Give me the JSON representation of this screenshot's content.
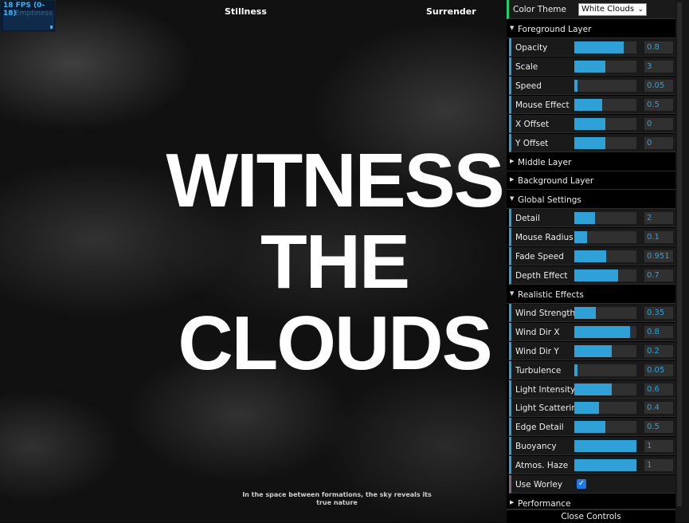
{
  "fps": {
    "label": "18 FPS (0-18)",
    "ghost_text": "Emptiness"
  },
  "nav": {
    "left": "Stillness",
    "right": "Surrender"
  },
  "headline": [
    "WITNESS",
    "THE",
    "CLOUDS"
  ],
  "tagline": "In the space between formations, the sky reveals its true nature",
  "panel": {
    "theme_label": "Color Theme",
    "theme_value": "White Clouds",
    "foreground": {
      "label": "Foreground Layer",
      "controls": [
        {
          "label": "Opacity",
          "value": "0.8",
          "fill": 0.8
        },
        {
          "label": "Scale",
          "value": "3",
          "fill": 0.5
        },
        {
          "label": "Speed",
          "value": "0.05",
          "fill": 0.05
        },
        {
          "label": "Mouse Effect",
          "value": "0.5",
          "fill": 0.45
        },
        {
          "label": "X Offset",
          "value": "0",
          "fill": 0.5
        },
        {
          "label": "Y Offset",
          "value": "0",
          "fill": 0.5
        }
      ]
    },
    "middle": {
      "label": "Middle Layer"
    },
    "background": {
      "label": "Background Layer"
    },
    "global": {
      "label": "Global Settings",
      "controls": [
        {
          "label": "Detail",
          "value": "2",
          "fill": 0.33
        },
        {
          "label": "Mouse Radius",
          "value": "0.1",
          "fill": 0.2
        },
        {
          "label": "Fade Speed",
          "value": "0.951",
          "fill": 0.51
        },
        {
          "label": "Depth Effect",
          "value": "0.7",
          "fill": 0.7
        }
      ]
    },
    "realistic": {
      "label": "Realistic Effects",
      "controls": [
        {
          "label": "Wind Strength",
          "value": "0.35",
          "fill": 0.35
        },
        {
          "label": "Wind Dir X",
          "value": "0.8",
          "fill": 0.9
        },
        {
          "label": "Wind Dir Y",
          "value": "0.2",
          "fill": 0.6
        },
        {
          "label": "Turbulence",
          "value": "0.05",
          "fill": 0.05
        },
        {
          "label": "Light Intensity",
          "value": "0.6",
          "fill": 0.6
        },
        {
          "label": "Light Scattering",
          "value": "0.4",
          "fill": 0.4
        },
        {
          "label": "Edge Detail",
          "value": "0.5",
          "fill": 0.5
        },
        {
          "label": "Buoyancy",
          "value": "1",
          "fill": 1
        },
        {
          "label": "Atmos. Haze",
          "value": "1",
          "fill": 1
        }
      ],
      "worley_label": "Use Worley",
      "worley_checked": true
    },
    "performance": {
      "label": "Performance"
    },
    "close_label": "Close Controls"
  }
}
